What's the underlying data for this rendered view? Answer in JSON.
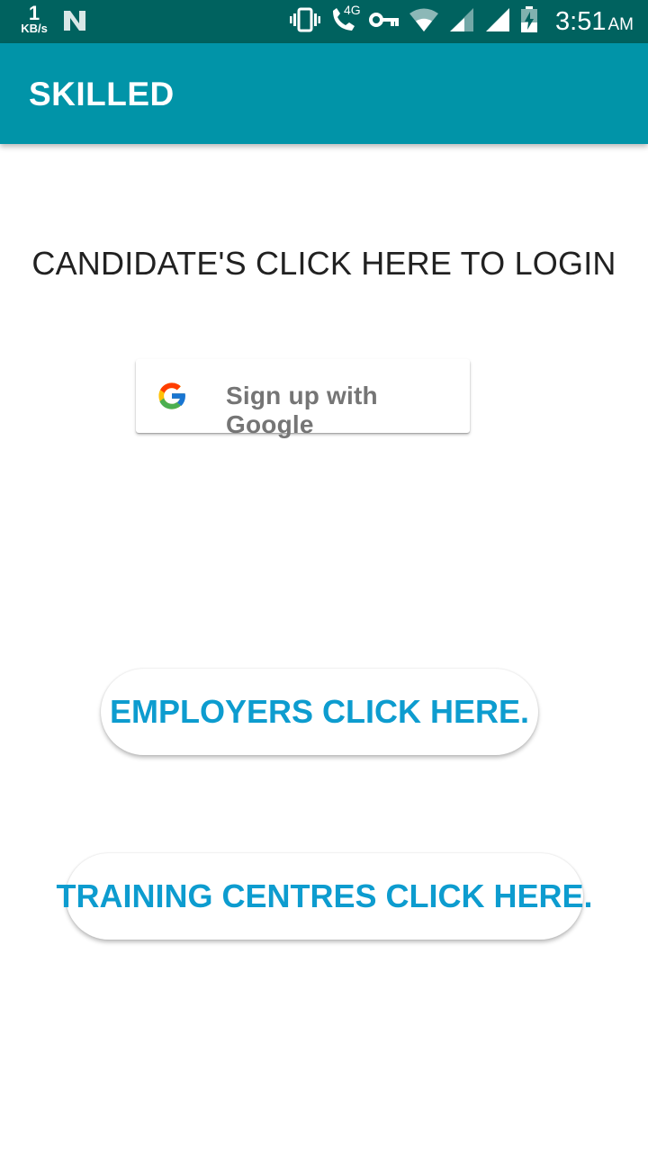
{
  "status_bar": {
    "net_speed_value": "1",
    "net_speed_unit": "KB/s",
    "time": "3:51",
    "ampm": "AM",
    "network_label": "4G",
    "icons": [
      "n-notification-icon",
      "vibrate-icon",
      "volte-call-icon",
      "vpn-key-icon",
      "wifi-icon",
      "signal-icon",
      "signal-icon",
      "battery-charging-icon"
    ]
  },
  "app_bar": {
    "title": "SKILLED",
    "color": "#0194a8"
  },
  "main": {
    "login_heading": "CANDIDATE'S CLICK HERE TO LOGIN",
    "google_button_label": "Sign up with Google",
    "employers_button_label": "EMPLOYERS CLICK HERE.",
    "training_centres_button_label": "TRAINING CENTRES CLICK HERE.",
    "button_text_color": "#0d9ccf"
  }
}
